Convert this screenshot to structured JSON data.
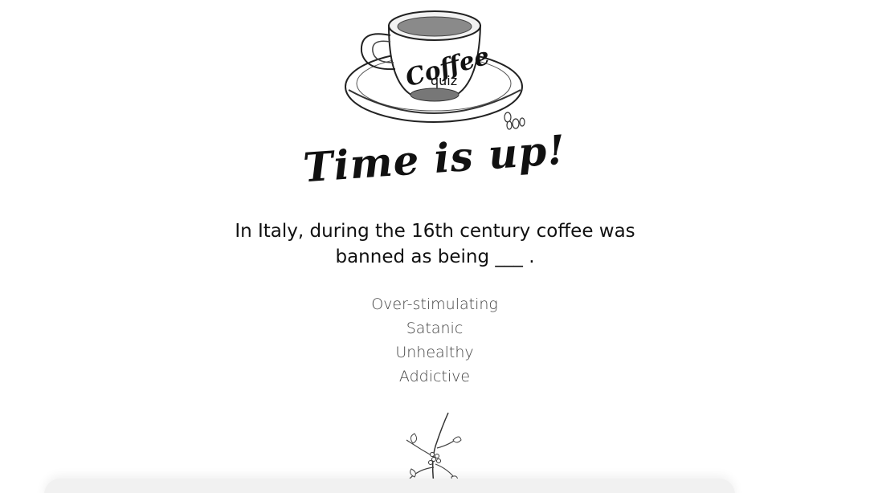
{
  "logo": {
    "word_1": "Coffee",
    "word_2": "quiz"
  },
  "title": "Time is up!",
  "question": {
    "text": "In Italy, during the 16th century coffee was banned as being ___ ."
  },
  "answers": [
    {
      "label": "Over-stimulating"
    },
    {
      "label": "Satanic"
    },
    {
      "label": "Unhealthy"
    },
    {
      "label": "Addictive"
    }
  ],
  "colors": {
    "ink": "#111111",
    "answer_text": "#444444",
    "background": "#ffffff"
  }
}
